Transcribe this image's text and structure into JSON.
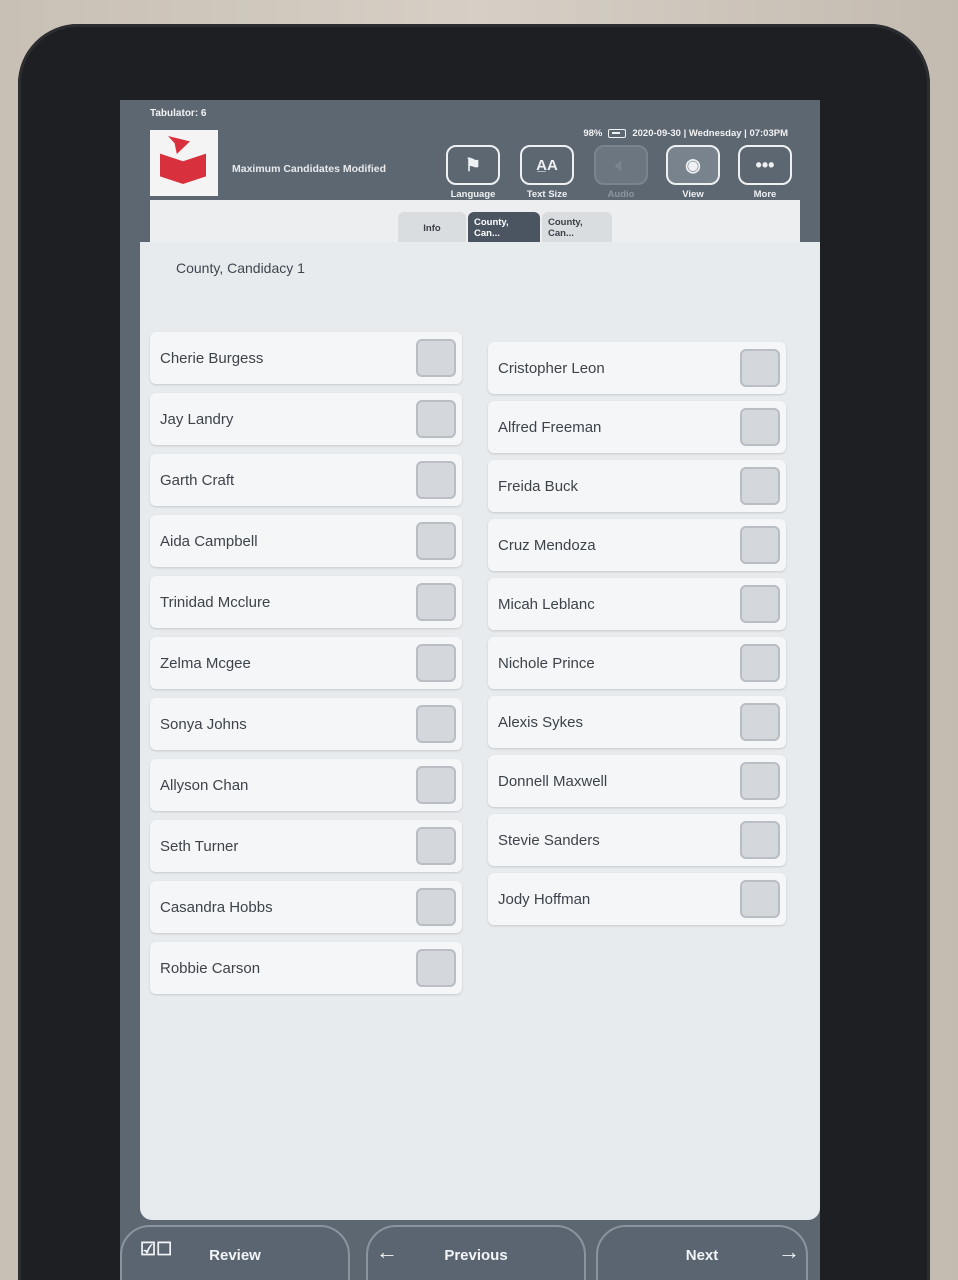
{
  "status": {
    "tabulator": "Tabulator: 6",
    "battery": "98%",
    "datetime": "2020-09-30 | Wednesday | 07:03PM"
  },
  "header": {
    "message": "Maximum Candidates Modified",
    "tools": [
      {
        "label": "Language",
        "icon": "flag-icon",
        "state": "enabled"
      },
      {
        "label": "Text Size",
        "icon": "text-size-icon",
        "state": "enabled"
      },
      {
        "label": "Audio",
        "icon": "speaker-icon",
        "state": "disabled"
      },
      {
        "label": "View",
        "icon": "eye-icon",
        "state": "active"
      },
      {
        "label": "More",
        "icon": "ellipsis-icon",
        "state": "enabled"
      }
    ]
  },
  "tabs": [
    "Info",
    "County, Can...",
    "County, Can..."
  ],
  "contest": {
    "title": "County, Candidacy 1",
    "left_candidates": [
      "Cherie Burgess",
      "Jay Landry",
      "Garth Craft",
      "Aida Campbell",
      "Trinidad Mcclure",
      "Zelma Mcgee",
      "Sonya Johns",
      "Allyson Chan",
      "Seth Turner",
      "Casandra Hobbs",
      "Robbie Carson"
    ],
    "right_candidates": [
      "Cristopher Leon",
      "Alfred Freeman",
      "Freida Buck",
      "Cruz Mendoza",
      "Micah Leblanc",
      "Nichole Prince",
      "Alexis Sykes",
      "Donnell Maxwell",
      "Stevie Sanders",
      "Jody Hoffman"
    ]
  },
  "nav": {
    "review": "Review",
    "previous": "Previous",
    "next": "Next"
  },
  "colors": {
    "brand_red": "#d9303e",
    "chrome": "#5d6772",
    "content_bg": "#e8ebee"
  }
}
